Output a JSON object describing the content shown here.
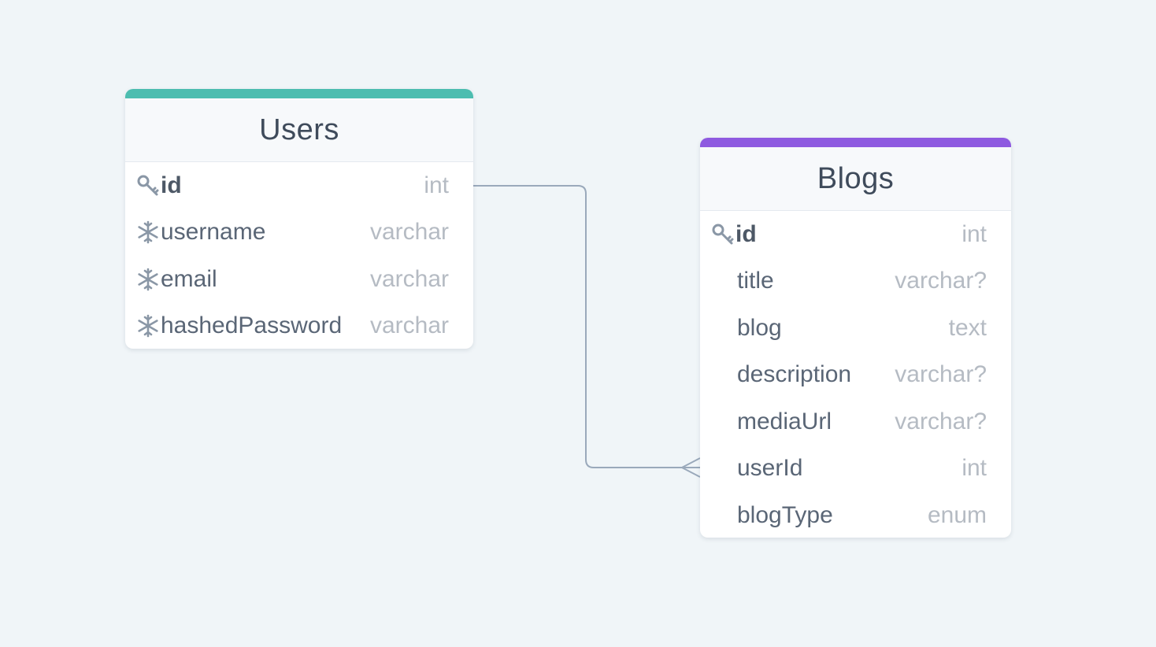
{
  "tables": {
    "users": {
      "name": "Users",
      "accent_color": "#4dbdb0",
      "fields": [
        {
          "name": "id",
          "type": "int",
          "icon": "key-icon",
          "primary": true
        },
        {
          "name": "username",
          "type": "varchar",
          "icon": "snowflake-icon"
        },
        {
          "name": "email",
          "type": "varchar",
          "icon": "snowflake-icon"
        },
        {
          "name": "hashedPassword",
          "type": "varchar",
          "icon": "snowflake-icon"
        }
      ]
    },
    "blogs": {
      "name": "Blogs",
      "accent_color": "#8e5ae0",
      "fields": [
        {
          "name": "id",
          "type": "int",
          "icon": "key-icon",
          "primary": true
        },
        {
          "name": "title",
          "type": "varchar?"
        },
        {
          "name": "blog",
          "type": "text"
        },
        {
          "name": "description",
          "type": "varchar?"
        },
        {
          "name": "mediaUrl",
          "type": "varchar?"
        },
        {
          "name": "userId",
          "type": "int"
        },
        {
          "name": "blogType",
          "type": "enum"
        }
      ]
    }
  },
  "relation": {
    "from": "Users.id",
    "to": "Blogs.userId",
    "cardinality": "one-to-many",
    "line_color": "#9aa9bb"
  }
}
